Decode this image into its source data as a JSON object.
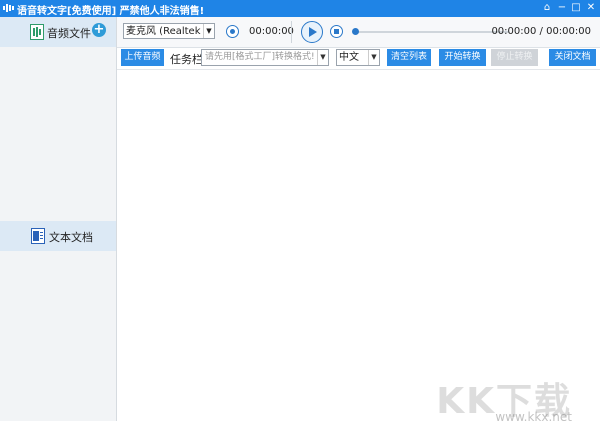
{
  "window": {
    "title": "语音转文字[免费使用]  严禁他人非法销售!",
    "controls": {
      "home": "⌂",
      "minimize": "−",
      "maximize": "□",
      "close": "✕"
    }
  },
  "sidebar": {
    "items": [
      {
        "label": "音频文件",
        "icon": "audio-file-icon",
        "add": "+"
      },
      {
        "label": "文本文档",
        "icon": "word-document-icon"
      }
    ]
  },
  "audiobar": {
    "microphone": "麦克风 (Realtek Audi",
    "record_time": "00:00:00",
    "play_time": "00:00:00 / 00:00:00"
  },
  "toolbar": {
    "upload": "上传音频",
    "task_label": "任务栏",
    "format_placeholder": "请先用[格式工厂]转换格式!",
    "language": "中文",
    "clear": "清空列表",
    "start": "开始转换",
    "stop": "停止转换",
    "close_doc": "关闭文档"
  },
  "watermark": {
    "text": "KK下载",
    "url": "www.kkx.net"
  },
  "colors": {
    "accent": "#1f84e6",
    "button": "#2b8be5",
    "disabled": "#cfd3d8"
  }
}
